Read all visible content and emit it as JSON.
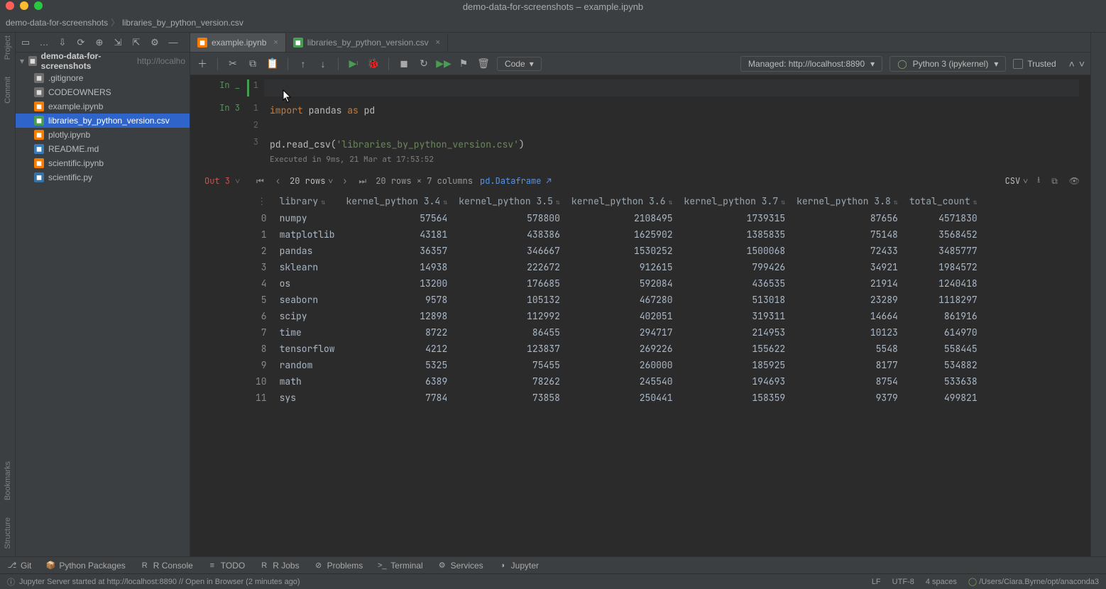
{
  "window": {
    "title": "demo-data-for-screenshots – example.ipynb"
  },
  "breadcrumb": {
    "project": "demo-data-for-screenshots",
    "file": "libraries_by_python_version.csv"
  },
  "left_rail": {
    "items": [
      "Project",
      "Commit",
      "Bookmarks",
      "Structure"
    ]
  },
  "project_pane": {
    "root_name": "demo-data-for-screenshots",
    "root_path": "http://localho",
    "files": [
      {
        "name": ".gitignore",
        "ico": "txt"
      },
      {
        "name": "CODEOWNERS",
        "ico": "txt"
      },
      {
        "name": "example.ipynb",
        "ico": "nb"
      },
      {
        "name": "libraries_by_python_version.csv",
        "ico": "csv",
        "selected": true
      },
      {
        "name": "plotly.ipynb",
        "ico": "nb"
      },
      {
        "name": "README.md",
        "ico": "md"
      },
      {
        "name": "scientific.ipynb",
        "ico": "nb"
      },
      {
        "name": "scientific.py",
        "ico": "py"
      }
    ]
  },
  "tabs": [
    {
      "label": "example.ipynb",
      "active": true,
      "ico": "nb"
    },
    {
      "label": "libraries_by_python_version.csv",
      "active": false,
      "ico": "csv"
    }
  ],
  "nb_toolbar": {
    "cell_type": "Code",
    "managed": "Managed: http://localhost:8890",
    "kernel": "Python 3 (ipykernel)",
    "trusted": "Trusted"
  },
  "cells": {
    "empty": {
      "prompt": "In _",
      "line": "1"
    },
    "code": {
      "prompt": "In 3",
      "lines": [
        {
          "n": "1",
          "tokens": [
            [
              "kw",
              "import"
            ],
            [
              "",
              " pandas "
            ],
            [
              "kw",
              "as"
            ],
            [
              "",
              " pd"
            ]
          ]
        },
        {
          "n": "2",
          "tokens": []
        },
        {
          "n": "3",
          "tokens": [
            [
              "",
              "pd.read_csv("
            ],
            [
              "str",
              "'libraries_by_python_version.csv'"
            ],
            [
              "",
              ")"
            ]
          ]
        }
      ],
      "exec": "Executed in 9ms, 21 Mar at 17:53:52"
    },
    "out": {
      "prompt": "Out 3",
      "rows_sel": "20 rows",
      "shape": "20 rows × 7 columns",
      "link": "pd.Dataframe",
      "export": "CSV"
    }
  },
  "dataframe": {
    "columns": [
      "library",
      "kernel_python 3.4",
      "kernel_python 3.5",
      "kernel_python 3.6",
      "kernel_python 3.7",
      "kernel_python 3.8",
      "total_count"
    ],
    "rows": [
      [
        "0",
        "numpy",
        "57564",
        "578800",
        "2108495",
        "1739315",
        "87656",
        "4571830"
      ],
      [
        "1",
        "matplotlib",
        "43181",
        "438386",
        "1625902",
        "1385835",
        "75148",
        "3568452"
      ],
      [
        "2",
        "pandas",
        "36357",
        "346667",
        "1530252",
        "1500068",
        "72433",
        "3485777"
      ],
      [
        "3",
        "sklearn",
        "14938",
        "222672",
        "912615",
        "799426",
        "34921",
        "1984572"
      ],
      [
        "4",
        "os",
        "13200",
        "176685",
        "592084",
        "436535",
        "21914",
        "1240418"
      ],
      [
        "5",
        "seaborn",
        "9578",
        "105132",
        "467280",
        "513018",
        "23289",
        "1118297"
      ],
      [
        "6",
        "scipy",
        "12898",
        "112992",
        "402051",
        "319311",
        "14664",
        "861916"
      ],
      [
        "7",
        "time",
        "8722",
        "86455",
        "294717",
        "214953",
        "10123",
        "614970"
      ],
      [
        "8",
        "tensorflow",
        "4212",
        "123837",
        "269226",
        "155622",
        "5548",
        "558445"
      ],
      [
        "9",
        "random",
        "5325",
        "75455",
        "260000",
        "185925",
        "8177",
        "534882"
      ],
      [
        "10",
        "math",
        "6389",
        "78262",
        "245540",
        "194693",
        "8754",
        "533638"
      ],
      [
        "11",
        "sys",
        "7784",
        "73858",
        "250441",
        "158359",
        "9379",
        "499821"
      ]
    ]
  },
  "tool_windows": [
    {
      "ico": "⎇",
      "label": "Git"
    },
    {
      "ico": "📦",
      "label": "Python Packages"
    },
    {
      "ico": "R",
      "label": "R Console"
    },
    {
      "ico": "≡",
      "label": "TODO"
    },
    {
      "ico": "R",
      "label": "R Jobs"
    },
    {
      "ico": "⊘",
      "label": "Problems"
    },
    {
      "ico": ">_",
      "label": "Terminal"
    },
    {
      "ico": "⚙",
      "label": "Services"
    },
    {
      "ico": "◑",
      "label": "Jupyter"
    }
  ],
  "status": {
    "msg": "Jupyter Server started at http://localhost:8890 // Open in Browser (2 minutes ago)",
    "lf": "LF",
    "enc": "UTF-8",
    "indent": "4 spaces",
    "interp": "/Users/Ciara.Byrne/opt/anaconda3"
  },
  "chart_data": {
    "type": "table",
    "title": "libraries_by_python_version.csv",
    "columns": [
      "library",
      "kernel_python 3.4",
      "kernel_python 3.5",
      "kernel_python 3.6",
      "kernel_python 3.7",
      "kernel_python 3.8",
      "total_count"
    ],
    "rows": [
      [
        "numpy",
        57564,
        578800,
        2108495,
        1739315,
        87656,
        4571830
      ],
      [
        "matplotlib",
        43181,
        438386,
        1625902,
        1385835,
        75148,
        3568452
      ],
      [
        "pandas",
        36357,
        346667,
        1530252,
        1500068,
        72433,
        3485777
      ],
      [
        "sklearn",
        14938,
        222672,
        912615,
        799426,
        34921,
        1984572
      ],
      [
        "os",
        13200,
        176685,
        592084,
        436535,
        21914,
        1240418
      ],
      [
        "seaborn",
        9578,
        105132,
        467280,
        513018,
        23289,
        1118297
      ],
      [
        "scipy",
        12898,
        112992,
        402051,
        319311,
        14664,
        861916
      ],
      [
        "time",
        8722,
        86455,
        294717,
        214953,
        10123,
        614970
      ],
      [
        "tensorflow",
        4212,
        123837,
        269226,
        155622,
        5548,
        558445
      ],
      [
        "random",
        5325,
        75455,
        260000,
        185925,
        8177,
        534882
      ],
      [
        "math",
        6389,
        78262,
        245540,
        194693,
        8754,
        533638
      ],
      [
        "sys",
        7784,
        73858,
        250441,
        158359,
        9379,
        499821
      ]
    ]
  }
}
